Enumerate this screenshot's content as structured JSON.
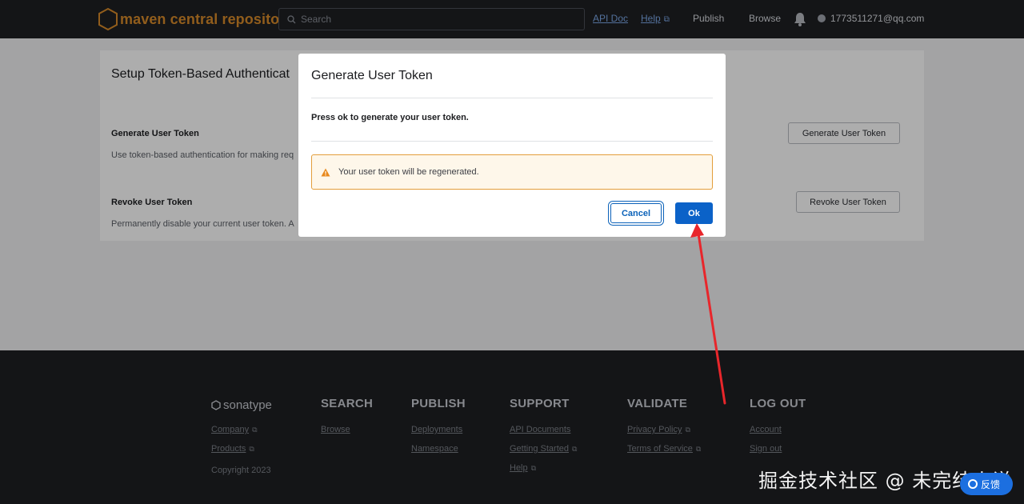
{
  "header": {
    "logo_text": "maven central repository",
    "search_placeholder": "Search",
    "nav": {
      "api_doc": "API Doc",
      "help": "Help",
      "publish": "Publish",
      "browse": "Browse"
    },
    "user_email": "1773511271@qq.com"
  },
  "card": {
    "title": "Setup Token-Based Authenticat",
    "generate": {
      "title": "Generate User Token",
      "desc": "Use token-based authentication for making req",
      "button": "Generate User Token"
    },
    "revoke": {
      "title": "Revoke User Token",
      "desc": "Permanently disable your current user token. A",
      "button": "Revoke User Token"
    }
  },
  "modal": {
    "title": "Generate User Token",
    "body": "Press ok to generate your user token.",
    "alert": "Your user token will be regenerated.",
    "cancel_label": "Cancel",
    "ok_label": "Ok"
  },
  "footer": {
    "brand": "sonatype",
    "company": "Company",
    "products": "Products",
    "copyright": "Copyright 2023",
    "search": {
      "heading": "SEARCH",
      "links": [
        "Browse"
      ]
    },
    "publish": {
      "heading": "PUBLISH",
      "links": [
        "Deployments",
        "Namespace"
      ]
    },
    "support": {
      "heading": "SUPPORT",
      "links": [
        "API Documents",
        "Getting Started",
        "Help"
      ]
    },
    "validate": {
      "heading": "VALIDATE",
      "links": [
        "Privacy Policy",
        "Terms of Service"
      ]
    },
    "logout": {
      "heading": "LOG OUT",
      "links": [
        "Account",
        "Sign out"
      ]
    }
  },
  "watermark": "掘金技术社区 @ 未完结小说",
  "chat_pill_label": "反馈",
  "colors": {
    "header_bg": "#1e1f22",
    "brand_orange": "#d68a2a",
    "primary_blue": "#0b62c8",
    "warning_border": "#e39e3b",
    "annotation_red": "#e8262b"
  }
}
